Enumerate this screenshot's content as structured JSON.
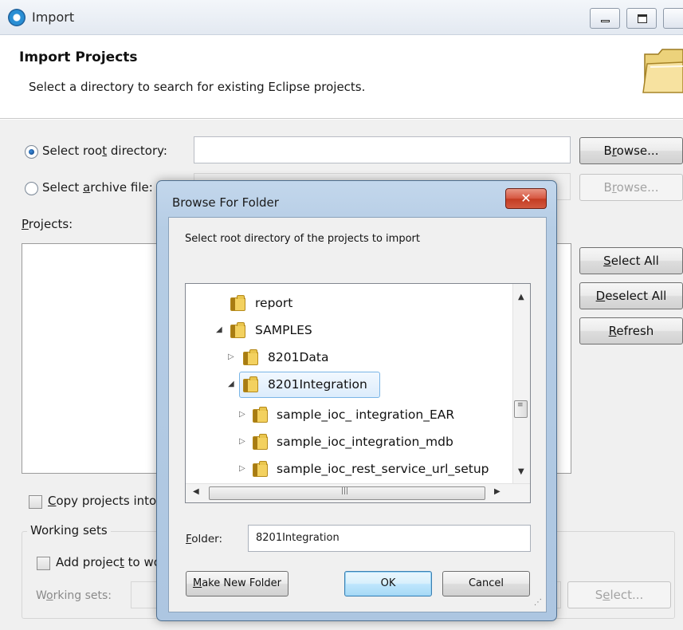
{
  "window": {
    "title": "Import",
    "minimize_icon": "minimize-icon",
    "maximize_icon": "maximize-icon"
  },
  "header": {
    "title": "Import Projects",
    "description": "Select a directory to search for existing Eclipse projects.",
    "banner_icon": "folder-icon"
  },
  "source": {
    "root_radio_label": "Select root directory:",
    "root_radio_checked": true,
    "root_path": "",
    "root_browse": "Browse...",
    "archive_radio_label": "Select archive file:",
    "archive_radio_checked": false,
    "archive_path": "",
    "archive_browse": "Browse..."
  },
  "projects": {
    "label": "Projects:",
    "select_all": "Select All",
    "deselect_all": "Deselect All",
    "refresh": "Refresh"
  },
  "options": {
    "copy_label": "Copy projects into workspace",
    "copy_checked": false
  },
  "working_sets": {
    "group_label": "Working sets",
    "add_label": "Add project to working sets",
    "add_checked": false,
    "sets_label": "Working sets:",
    "sets_value": "",
    "select_button": "Select..."
  },
  "browse_dialog": {
    "title": "Browse For Folder",
    "close_icon": "close-icon",
    "description": "Select root directory of the projects to import",
    "tree": [
      {
        "label": "report",
        "expander": "none",
        "selected": false
      },
      {
        "label": "SAMPLES",
        "expander": "expanded",
        "selected": false
      },
      {
        "label": "8201Data",
        "expander": "collapsed",
        "selected": false
      },
      {
        "label": "8201Integration",
        "expander": "expanded",
        "selected": true
      },
      {
        "label": "sample_ioc_ integration_EAR",
        "expander": "collapsed",
        "selected": false
      },
      {
        "label": "sample_ioc_integration_mdb",
        "expander": "collapsed",
        "selected": false
      },
      {
        "label": "sample_ioc_rest_service_url_setup",
        "expander": "collapsed",
        "selected": false
      }
    ],
    "folder_label": "Folder:",
    "folder_value": "8201Integration",
    "make_new_folder": "Make New Folder",
    "ok": "OK",
    "cancel": "Cancel"
  }
}
